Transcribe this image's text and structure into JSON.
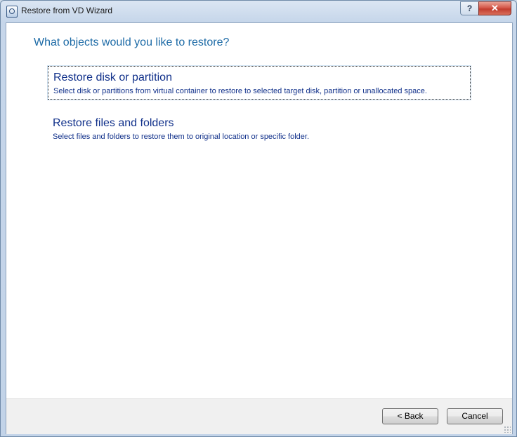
{
  "window": {
    "title": "Restore from VD Wizard",
    "help_label": "?",
    "close_label": "✕"
  },
  "main": {
    "heading": "What objects would you like to restore?",
    "options": [
      {
        "title": "Restore disk or partition",
        "description": "Select disk or partitions from virtual container to restore to selected target disk, partition or unallocated space."
      },
      {
        "title": "Restore files and folders",
        "description": "Select files and folders to restore them to original location or specific folder."
      }
    ]
  },
  "footer": {
    "back_label": "< Back",
    "cancel_label": "Cancel"
  },
  "colors": {
    "heading": "#1c6aa6",
    "option_text": "#10308a",
    "close_button": "#c23d2f"
  },
  "icons": {
    "app": "app-icon",
    "help": "help-icon",
    "close": "close-icon"
  }
}
